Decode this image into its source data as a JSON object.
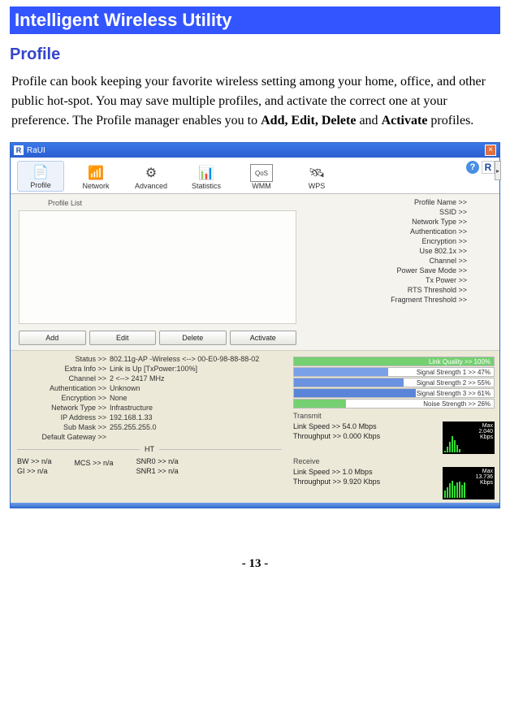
{
  "doc": {
    "heading": "Intelligent Wireless Utility",
    "section": "Profile",
    "paragraph_pre": "Profile can book keeping your favorite wireless setting among your home, office, and other public hot-spot. You may save multiple profiles, and activate the correct one at your preference. The Profile manager enables you to ",
    "paragraph_bold1": "Add, Edit, Delete",
    "paragraph_mid": " and ",
    "paragraph_bold2": "Activate",
    "paragraph_post": " profiles.",
    "page_number": "- 13 -"
  },
  "win": {
    "title": "RaUI",
    "close": "×",
    "toolbar": {
      "items": [
        {
          "label": "Profile"
        },
        {
          "label": "Network"
        },
        {
          "label": "Advanced"
        },
        {
          "label": "Statistics"
        },
        {
          "label": "WMM"
        },
        {
          "label": "WPS"
        }
      ]
    },
    "profile_list_label": "Profile List",
    "details": [
      "Profile Name >>",
      "SSID >>",
      "Network Type >>",
      "Authentication >>",
      "Encryption >>",
      "Use 802.1x >>",
      "Channel >>",
      "Power Save Mode >>",
      "Tx Power >>",
      "RTS Threshold >>",
      "Fragment Threshold >>"
    ],
    "buttons": [
      "Add",
      "Edit",
      "Delete",
      "Activate"
    ],
    "status": [
      {
        "k": "Status >>",
        "v": "802.11g-AP -Wireless  <--> 00-E0-98-88-88-02"
      },
      {
        "k": "Extra Info >>",
        "v": "Link is Up [TxPower:100%]"
      },
      {
        "k": "Channel >>",
        "v": "2 <--> 2417 MHz"
      },
      {
        "k": "Authentication >>",
        "v": "Unknown"
      },
      {
        "k": "Encryption >>",
        "v": "None"
      },
      {
        "k": "Network Type >>",
        "v": "Infrastructure"
      },
      {
        "k": "IP Address >>",
        "v": "192.168.1.33"
      },
      {
        "k": "Sub Mask >>",
        "v": "255.255.255.0"
      },
      {
        "k": "Default Gateway >>",
        "v": ""
      }
    ],
    "ht_label": "HT",
    "ht_cols": {
      "left": [
        "BW >> n/a",
        "GI >> n/a"
      ],
      "mid": [
        "",
        "MCS >> n/a"
      ],
      "right": [
        "SNR0 >> n/a",
        "SNR1 >> n/a"
      ]
    },
    "signals": [
      {
        "label": "Link Quality >> 100%",
        "pct": 100,
        "cls": "green"
      },
      {
        "label": "Signal Strength 1 >> 47%",
        "pct": 47,
        "cls": "blue1"
      },
      {
        "label": "Signal Strength 2 >> 55%",
        "pct": 55,
        "cls": "blue2"
      },
      {
        "label": "Signal Strength 3 >> 61%",
        "pct": 61,
        "cls": "blue3"
      },
      {
        "label": "Noise Strength >> 26%",
        "pct": 26,
        "cls": "green"
      }
    ],
    "transmit": {
      "title": "Transmit",
      "link_speed": "Link Speed >> 54.0 Mbps",
      "throughput": "Throughput >> 0.000 Kbps",
      "max_label": "Max",
      "max_val": "2.040",
      "max_unit": "Kbps"
    },
    "receive": {
      "title": "Receive",
      "link_speed": "Link Speed >> 1.0 Mbps",
      "throughput": "Throughput >> 9.920 Kbps",
      "max_label": "Max",
      "max_val": "13.736",
      "max_unit": "Kbps"
    }
  },
  "chart_data": [
    {
      "type": "bar",
      "title": "Link Quality / Signal / Noise",
      "series": [
        {
          "name": "Link Quality",
          "values": [
            100
          ]
        },
        {
          "name": "Signal Strength 1",
          "values": [
            47
          ]
        },
        {
          "name": "Signal Strength 2",
          "values": [
            55
          ]
        },
        {
          "name": "Signal Strength 3",
          "values": [
            61
          ]
        },
        {
          "name": "Noise Strength",
          "values": [
            26
          ]
        }
      ],
      "ylim": [
        0,
        100
      ],
      "ylabel": "%"
    },
    {
      "type": "bar",
      "title": "Transmit Throughput",
      "ylabel": "Kbps",
      "ylim": [
        0,
        2.04
      ],
      "annotations": [
        "Max 2.040 Kbps"
      ],
      "values": [
        0.0
      ]
    },
    {
      "type": "bar",
      "title": "Receive Throughput",
      "ylabel": "Kbps",
      "ylim": [
        0,
        13.736
      ],
      "annotations": [
        "Max 13.736 Kbps"
      ],
      "values": [
        9.92
      ]
    }
  ]
}
